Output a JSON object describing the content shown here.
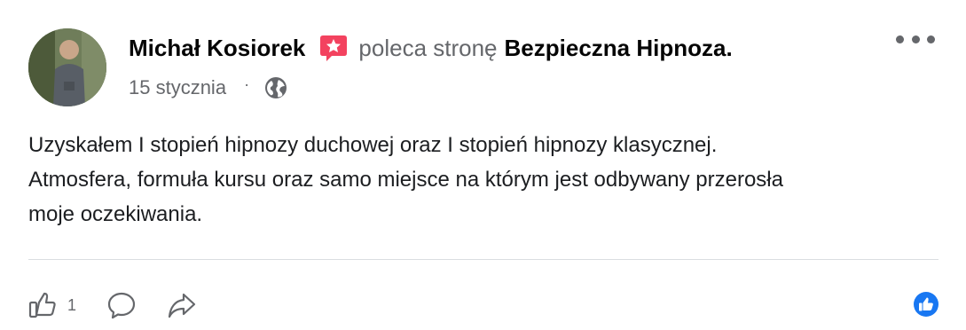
{
  "post": {
    "author": "Michał Kosiorek",
    "recommends_text": "poleca stronę",
    "page_name": "Bezpieczna Hipnoza.",
    "date": "15 stycznia",
    "separator": "·",
    "privacy_icon": "globe-icon",
    "recommendation_icon": "recommendation-star-icon",
    "text_lines": [
      "Uzyskałem I stopień hipnozy duchowej oraz I stopień hipnozy klasycznej.",
      "Atmosfera, formuła kursu oraz samo miejsce na którym jest odbywany przerosła",
      "moje oczekiwania."
    ]
  },
  "actions": {
    "like_count": "1",
    "like_icon": "thumbs-up-icon",
    "comment_icon": "comment-icon",
    "share_icon": "share-icon",
    "reaction_icon": "like-reaction-icon"
  },
  "colors": {
    "recommend_badge": "#f3425f",
    "secondary_text": "#65676b",
    "primary_text": "#050505",
    "reaction_blue": "#1877f2"
  }
}
